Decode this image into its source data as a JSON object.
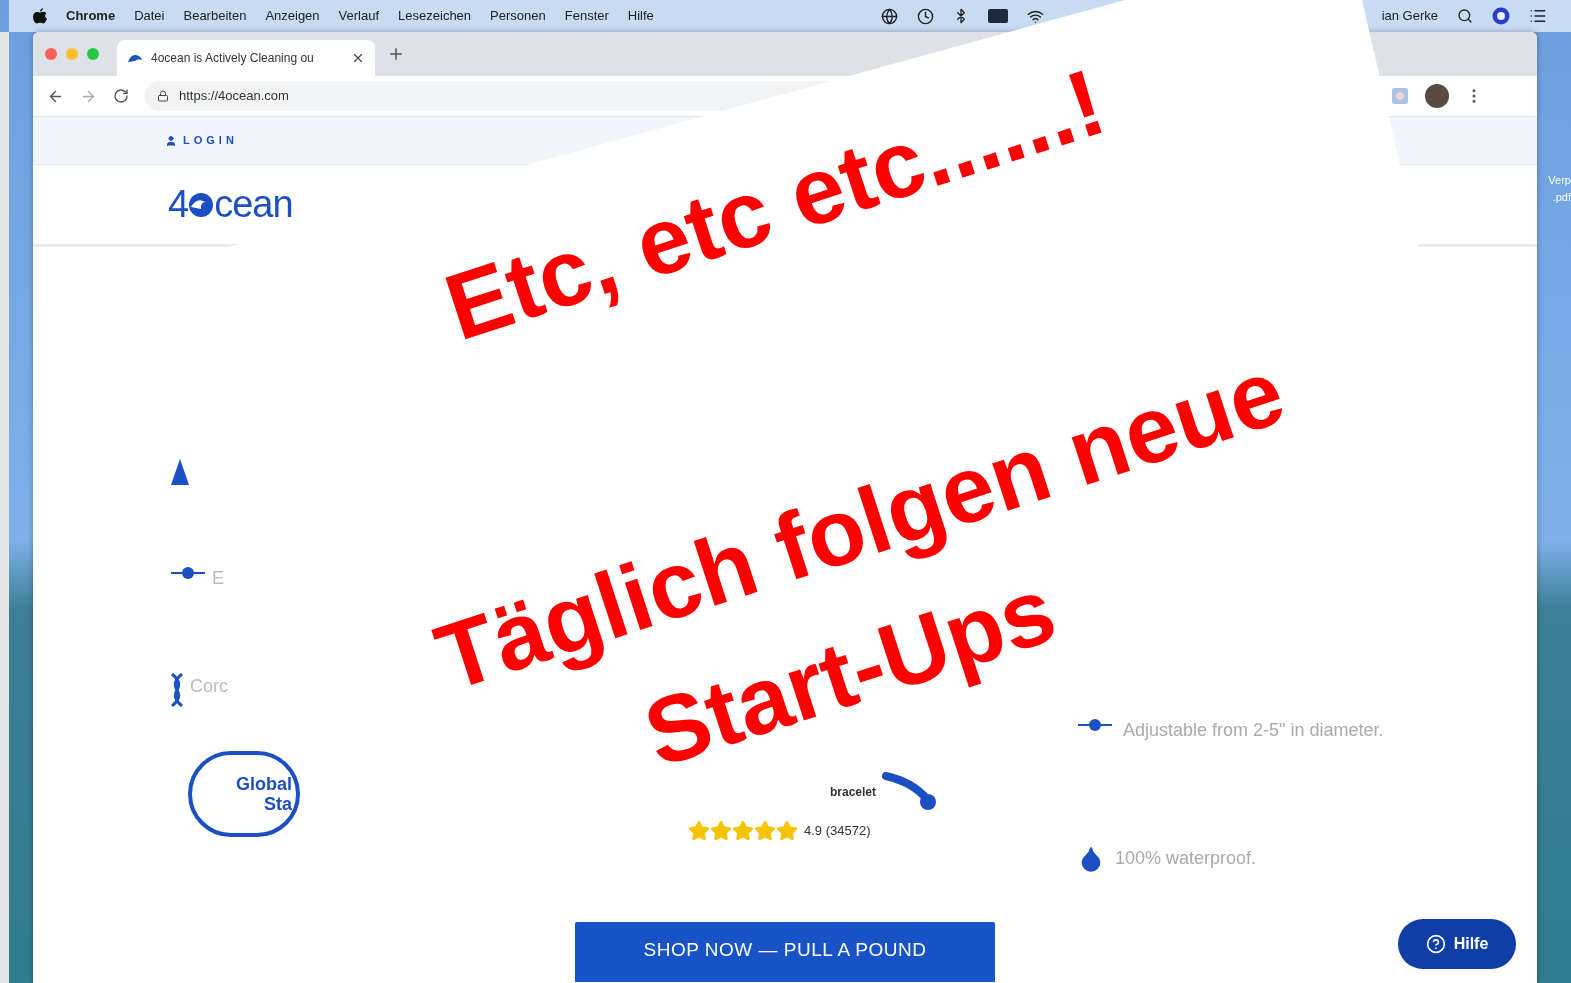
{
  "menu_bar": {
    "app": "Chrome",
    "items": [
      "Datei",
      "Bearbeiten",
      "Anzeigen",
      "Verlauf",
      "Lesezeichen",
      "Personen",
      "Fenster",
      "Hilfe"
    ],
    "user": "ian Gerke"
  },
  "desktop_labels": [
    "Verp",
    ".pdf"
  ],
  "browser": {
    "tab": {
      "title": "4ocean is Actively Cleaning ou",
      "selected": true
    },
    "url": "https://4ocean.com"
  },
  "page": {
    "login": "LOGIN",
    "logo_text": [
      "4",
      "cean"
    ],
    "features_left": [
      {
        "kind": "triangle"
      },
      {
        "kind": "dot",
        "text": "E"
      },
      {
        "kind": "strand",
        "text": "Corc"
      }
    ],
    "badge": [
      "Global",
      "Sta"
    ],
    "product": {
      "label": "bracelet",
      "stars": 5,
      "rating": "4.9 (34572)"
    },
    "features_right": [
      {
        "kind": "dot",
        "text": "Adjustable from 2-5\" in diameter."
      },
      {
        "kind": "drop",
        "text": "100% waterproof."
      }
    ],
    "shop_button": "SHOP NOW — PULL A POUND",
    "help_button": "Hilfe"
  },
  "overlay": {
    "lines": [
      "Etc, etc etc......!",
      "Täglich folgen neue",
      "Start-Ups"
    ]
  }
}
